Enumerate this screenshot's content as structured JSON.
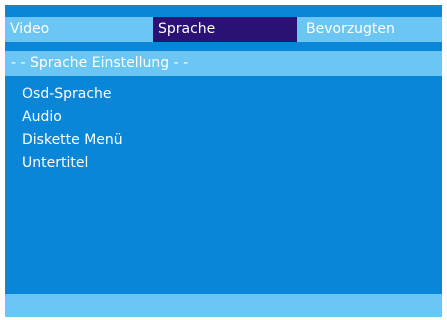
{
  "tabs": [
    {
      "label": "Video"
    },
    {
      "label": "Sprache"
    },
    {
      "label": "Bevorzugten"
    }
  ],
  "active_tab": "Sprache",
  "section": {
    "title": "- - Sprache Einstellung - -"
  },
  "menu": {
    "items": [
      {
        "label": "Osd-Sprache"
      },
      {
        "label": "Audio"
      },
      {
        "label": "Diskette Menü"
      },
      {
        "label": "Untertitel"
      }
    ]
  },
  "colors": {
    "background": "#0a86d8",
    "bar": "#6cc6f3",
    "active_tab": "#2a1175",
    "text": "#ffffff"
  }
}
